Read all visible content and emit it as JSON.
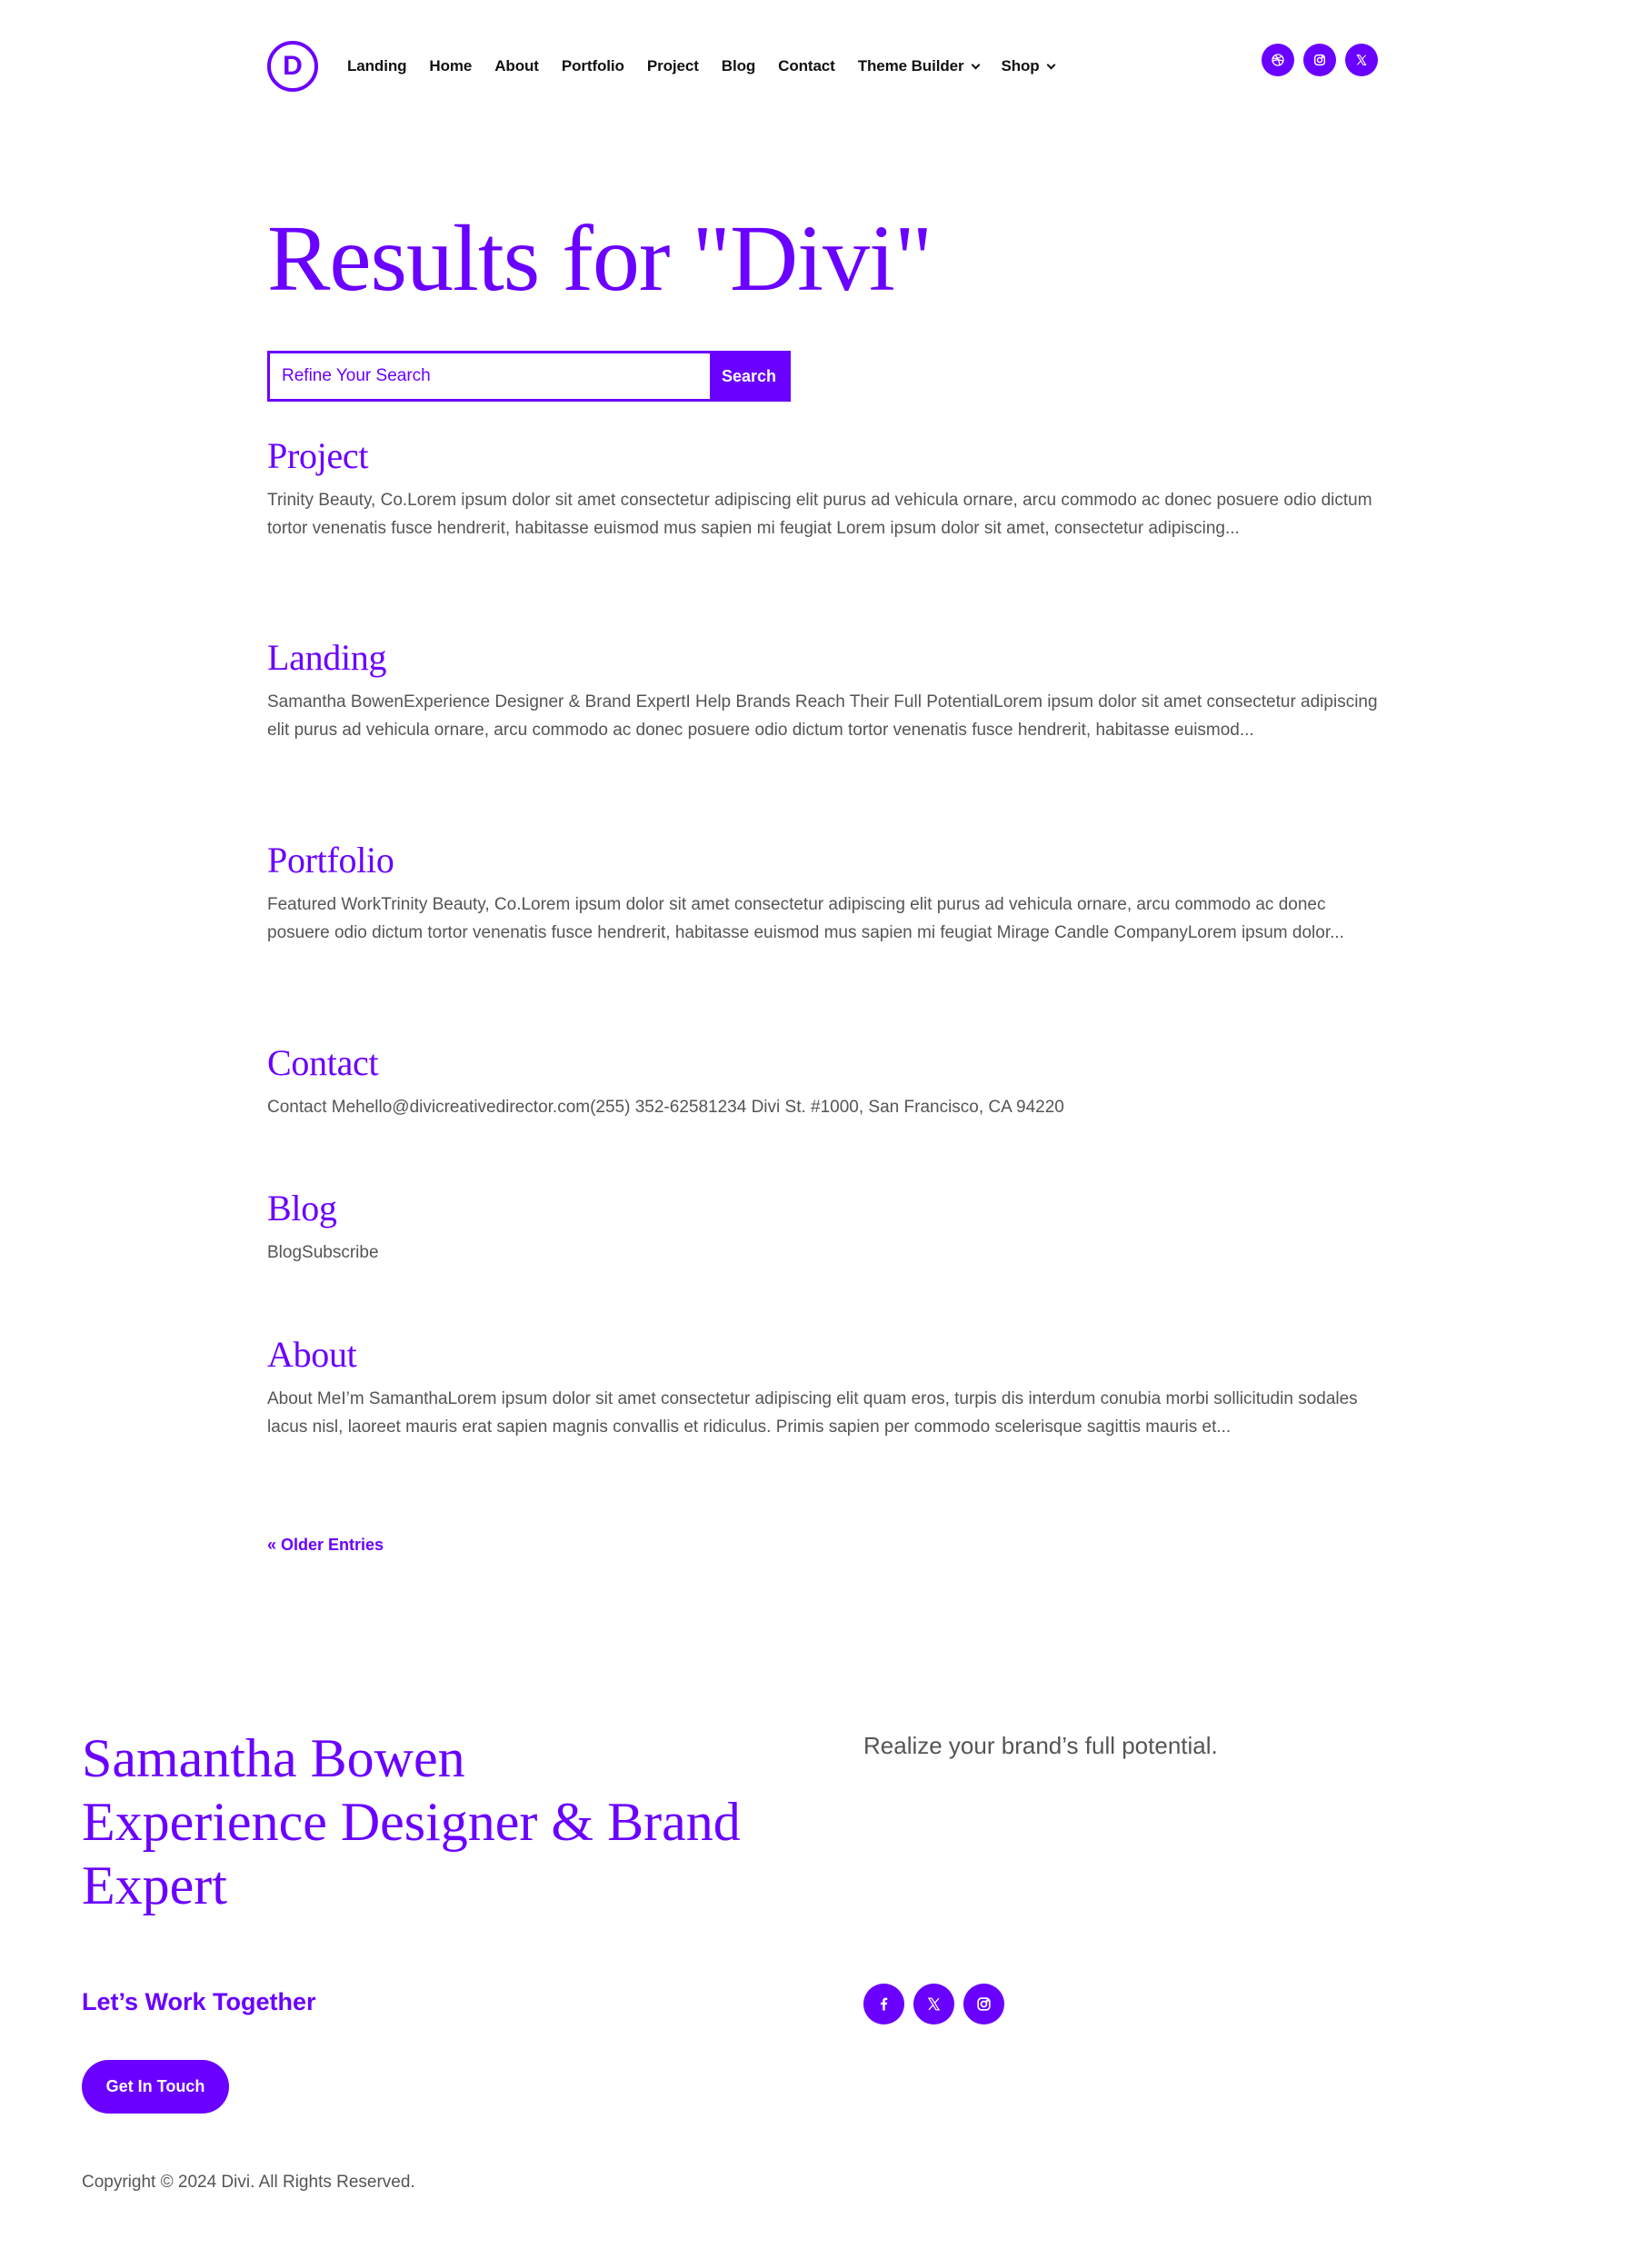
{
  "brand": {
    "logo_letter": "D",
    "accent_color": "#6a00ff"
  },
  "nav": {
    "items": [
      {
        "label": "Landing"
      },
      {
        "label": "Home"
      },
      {
        "label": "About"
      },
      {
        "label": "Portfolio"
      },
      {
        "label": "Project"
      },
      {
        "label": "Blog"
      },
      {
        "label": "Contact"
      },
      {
        "label": "Theme Builder",
        "has_dropdown": true
      },
      {
        "label": "Shop",
        "has_dropdown": true
      }
    ]
  },
  "header_social": [
    {
      "icon": "dribbble-icon"
    },
    {
      "icon": "instagram-icon"
    },
    {
      "icon": "x-twitter-icon"
    }
  ],
  "page": {
    "title": "Results for \"Divi\"",
    "search": {
      "placeholder": "Refine Your Search",
      "value": "",
      "button_label": "Search"
    }
  },
  "results": [
    {
      "title": "Project",
      "excerpt": "Trinity Beauty, Co.Lorem ipsum dolor sit amet consectetur adipiscing elit purus ad vehicula ornare, arcu commodo ac donec posuere odio dictum tortor venenatis fusce hendrerit, habitasse euismod mus sapien mi feugiat Lorem ipsum dolor sit amet, consectetur adipiscing..."
    },
    {
      "title": "Landing",
      "excerpt": "Samantha BowenExperience Designer & Brand ExpertI Help Brands Reach Their Full PotentialLorem ipsum dolor sit amet consectetur adipiscing elit purus ad vehicula ornare, arcu commodo ac donec posuere odio dictum tortor venenatis fusce hendrerit, habitasse euismod..."
    },
    {
      "title": "Portfolio",
      "excerpt": "Featured WorkTrinity Beauty, Co.Lorem ipsum dolor sit amet consectetur adipiscing elit purus ad vehicula ornare, arcu commodo ac donec posuere odio dictum tortor venenatis fusce hendrerit, habitasse euismod mus sapien mi feugiat Mirage Candle CompanyLorem ipsum dolor..."
    },
    {
      "title": "Contact",
      "excerpt": "Contact Mehello@divicreativedirector.com(255) 352-62581234 Divi St. #1000, San Francisco, CA 94220"
    },
    {
      "title": "Blog",
      "excerpt": "BlogSubscribe"
    },
    {
      "title": "About",
      "excerpt": "About MeI’m SamanthaLorem ipsum dolor sit amet consectetur adipiscing elit quam eros, turpis dis interdum conubia morbi sollicitudin sodales lacus nisl, laoreet mauris erat sapien magnis convallis et ridiculus. Primis sapien per commodo scelerisque sagittis mauris et..."
    }
  ],
  "pagination": {
    "older_label": "« Older Entries"
  },
  "footer": {
    "name_line1": "Samantha Bowen",
    "name_line2": "Experience Designer & Brand Expert",
    "tagline": "Realize your brand’s full potential.",
    "cta_heading": "Let’s Work Together",
    "cta_button": "Get In Touch",
    "social": [
      {
        "icon": "facebook-icon"
      },
      {
        "icon": "x-twitter-icon"
      },
      {
        "icon": "instagram-icon"
      }
    ],
    "copyright": "Copyright © 2024 Divi. All Rights Reserved."
  }
}
